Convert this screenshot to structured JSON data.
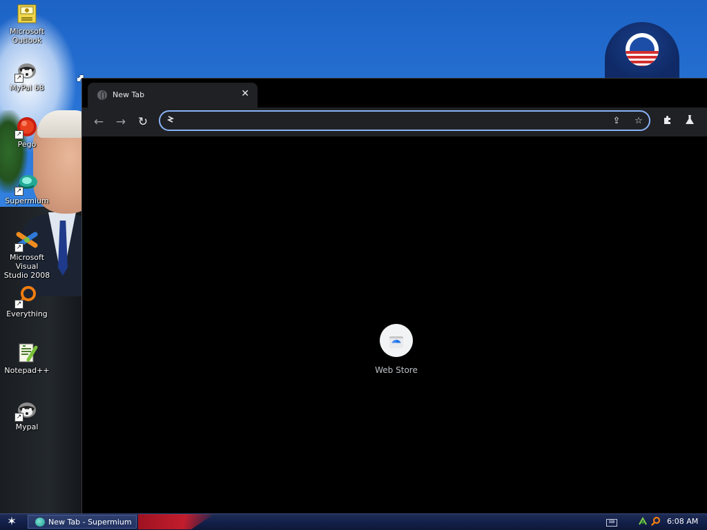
{
  "desktop": {
    "icons": [
      {
        "label": "Microsoft\nOutlook",
        "icon": "outlook-icon"
      },
      {
        "label": "MyPal 68",
        "icon": "raccoon-icon"
      },
      {
        "label": "Pego",
        "icon": "pego-icon"
      },
      {
        "label": "Supermium",
        "icon": "supermium-icon"
      },
      {
        "label": "Microsoft Visual\nStudio 2008",
        "icon": "visual-studio-icon"
      },
      {
        "label": "Everything",
        "icon": "everything-search-icon"
      },
      {
        "label": "Notepad++",
        "icon": "notepad-plus-plus-icon"
      },
      {
        "label": "Mypal",
        "icon": "raccoon-icon"
      }
    ]
  },
  "browser": {
    "tab": {
      "title": "New Tab",
      "close_glyph": "✕",
      "favicon": "globe-icon"
    },
    "toolbar": {
      "back": "←",
      "forward": "→",
      "reload": "↻",
      "omnibox_value": "",
      "share": "⇪",
      "bookmark": "☆",
      "extensions": "✚",
      "labs": "⚗"
    },
    "shortcuts": [
      {
        "label": "Web Store",
        "icon": "web-store-icon"
      }
    ]
  },
  "taskbar": {
    "start": "✶",
    "task_label": "New Tab - Supermium",
    "tray_keyboard": "⌨",
    "clock": "6:08 AM"
  },
  "colors": {
    "omnibox_focus": "#8ab4f8",
    "toolbar_bg": "#202124",
    "page_bg": "#000000",
    "taskbar_bg": "#13204a"
  }
}
